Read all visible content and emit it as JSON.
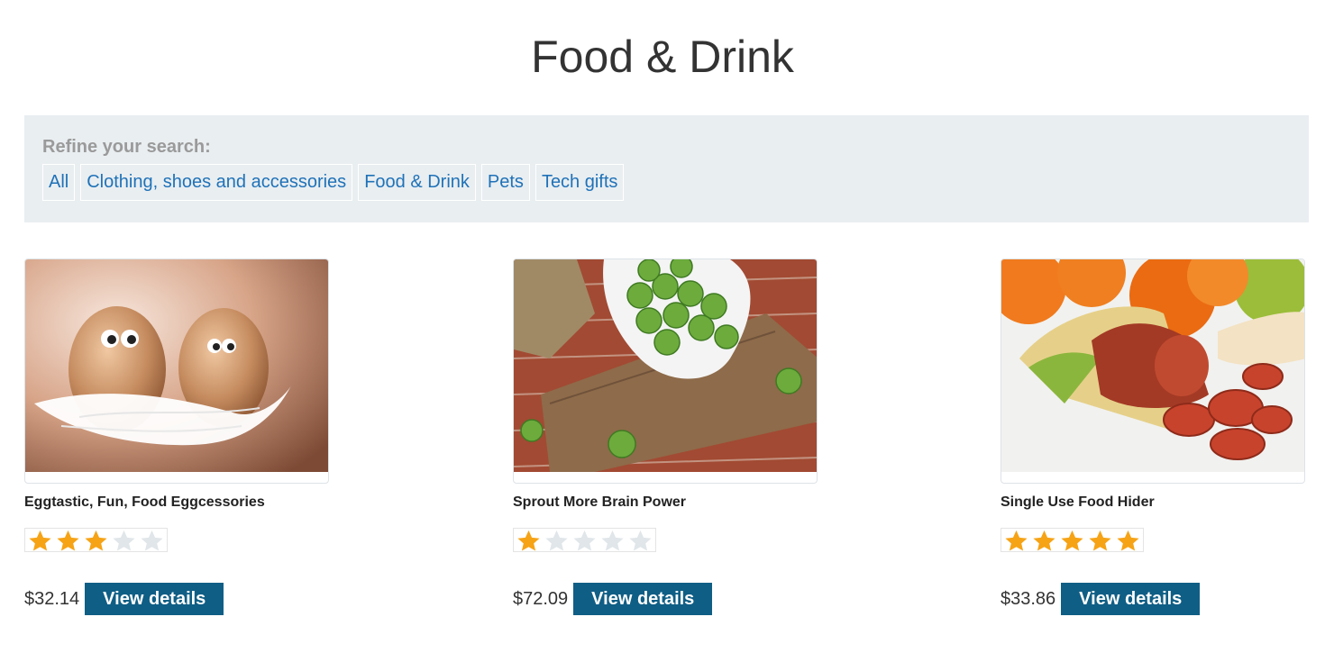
{
  "page": {
    "title": "Food & Drink"
  },
  "filters": {
    "heading": "Refine your search:",
    "items": [
      {
        "label": "All"
      },
      {
        "label": "Clothing, shoes and accessories"
      },
      {
        "label": "Food & Drink"
      },
      {
        "label": "Pets"
      },
      {
        "label": "Tech gifts"
      }
    ]
  },
  "products": [
    {
      "name": "Eggtastic, Fun, Food Eggcessories",
      "rating": 3,
      "rating_max": 5,
      "price": "$32.14",
      "button_label": "View details",
      "image": "eggs-with-feathers"
    },
    {
      "name": "Sprout More Brain Power",
      "rating": 1,
      "rating_max": 5,
      "price": "$72.09",
      "button_label": "View details",
      "image": "brussels-sprouts-bowl"
    },
    {
      "name": "Single Use Food Hider",
      "rating": 5,
      "rating_max": 5,
      "price": "$33.86",
      "button_label": "View details",
      "image": "sausage-in-banana-peel"
    }
  ],
  "colors": {
    "star_filled": "#f6a316",
    "star_empty": "#e0e6e9",
    "button_bg": "#0f5e85",
    "link": "#1f72b8",
    "filter_bg": "#e9eef1"
  }
}
